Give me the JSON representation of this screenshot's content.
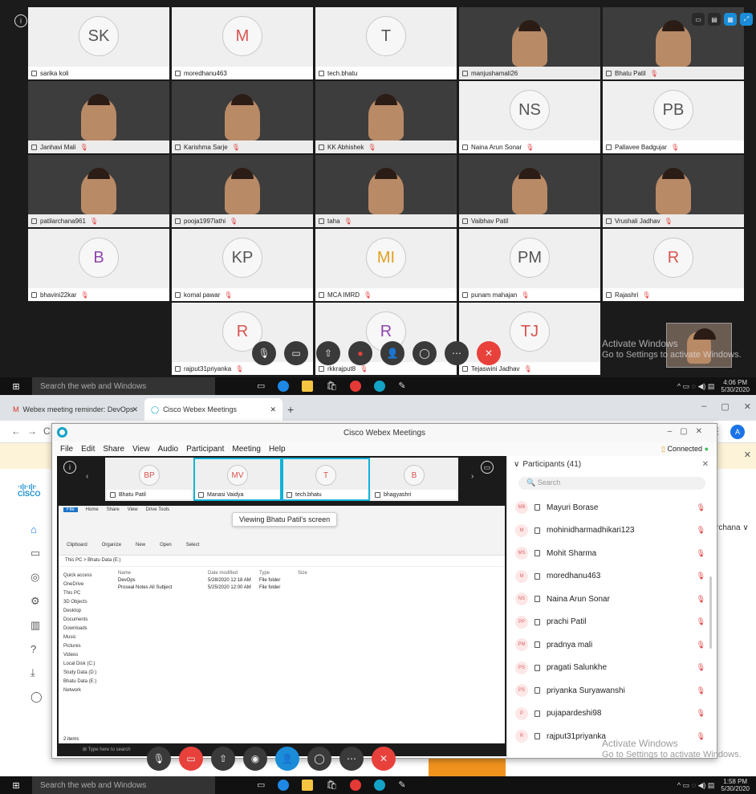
{
  "top": {
    "tiles": [
      {
        "name": "sarika koli",
        "initials": "SK",
        "kind": "avatar",
        "color": "#555555",
        "mic": false
      },
      {
        "name": "moredhanu463",
        "initials": "M",
        "kind": "avatar",
        "color": "#d9534f",
        "mic": false
      },
      {
        "name": "tech.bhatu",
        "initials": "T",
        "kind": "avatar",
        "color": "#555555",
        "mic": false
      },
      {
        "name": "manjushamali26",
        "initials": "",
        "kind": "video",
        "mic": false
      },
      {
        "name": "Bhatu Patil",
        "initials": "",
        "kind": "video",
        "mic": true
      },
      {
        "name": "Janhavi Mali",
        "initials": "",
        "kind": "video",
        "mic": true
      },
      {
        "name": "Karishma Sarje",
        "initials": "",
        "kind": "video",
        "mic": true
      },
      {
        "name": "KK Abhishek",
        "initials": "",
        "kind": "video",
        "mic": true
      },
      {
        "name": "Naina Arun Sonar",
        "initials": "NS",
        "kind": "avatar",
        "color": "#555555",
        "mic": true
      },
      {
        "name": "Pallavee Badgujar",
        "initials": "PB",
        "kind": "avatar",
        "color": "#555555",
        "mic": true
      },
      {
        "name": "patilarchana961",
        "initials": "",
        "kind": "video",
        "mic": true
      },
      {
        "name": "pooja1997lathi",
        "initials": "",
        "kind": "video",
        "mic": true
      },
      {
        "name": "taha",
        "initials": "",
        "kind": "video",
        "mic": true
      },
      {
        "name": "Vaibhav Patil",
        "initials": "",
        "kind": "video",
        "mic": false
      },
      {
        "name": "Vrushali Jadhav",
        "initials": "",
        "kind": "video",
        "mic": true
      },
      {
        "name": "bhavini22kar",
        "initials": "B",
        "kind": "avatar",
        "color": "#8e44ad",
        "mic": true
      },
      {
        "name": "komal pawar",
        "initials": "KP",
        "kind": "avatar",
        "color": "#555555",
        "mic": true
      },
      {
        "name": "MCA IMRD",
        "initials": "MI",
        "kind": "avatar",
        "color": "#e0a020",
        "mic": true
      },
      {
        "name": "punam mahajan",
        "initials": "PM",
        "kind": "avatar",
        "color": "#555555",
        "mic": true
      },
      {
        "name": "Rajashri",
        "initials": "R",
        "kind": "avatar",
        "color": "#d9534f",
        "mic": true
      },
      {
        "name": "",
        "initials": "",
        "kind": "empty",
        "mic": false
      },
      {
        "name": "rajput31priyanka",
        "initials": "R",
        "kind": "avatar",
        "color": "#d9534f",
        "mic": true
      },
      {
        "name": "rkkrajput8",
        "initials": "R",
        "kind": "avatar",
        "color": "#8e44ad",
        "mic": true
      },
      {
        "name": "Tejaswini Jadhav",
        "initials": "TJ",
        "kind": "avatar",
        "color": "#d9534f",
        "mic": true
      },
      {
        "name": "",
        "initials": "",
        "kind": "empty",
        "mic": false
      }
    ],
    "activate_title": "Activate Windows",
    "activate_sub": "Go to Settings to activate Windows.",
    "taskbar_search": "Search the web and Windows",
    "time": "4:06 PM",
    "date": "5/30/2020"
  },
  "browser": {
    "tab1": "Webex meeting reminder: DevOps",
    "tab2": "Cisco Webex Meetings",
    "archana": "rchana",
    "logo": "CISCO"
  },
  "webex": {
    "title": "Cisco Webex Meetings",
    "menu": [
      "File",
      "Edit",
      "Share",
      "View",
      "Audio",
      "Participant",
      "Meeting",
      "Help"
    ],
    "connected": "Connected",
    "strip": [
      {
        "name": "Bhatu Patil",
        "initials": "BP",
        "sel": false
      },
      {
        "name": "Manasi Vaidya",
        "initials": "MV",
        "sel": true
      },
      {
        "name": "tech.bhatu",
        "initials": "T",
        "sel": true
      },
      {
        "name": "bhagyashri",
        "initials": "B",
        "sel": false
      }
    ],
    "viewing": "Viewing Bhatu Patil's screen",
    "explorer": {
      "tabs": [
        "File",
        "Home",
        "Share",
        "View",
        "Drive Tools"
      ],
      "groups": [
        "Clipboard",
        "Organize",
        "New",
        "Open",
        "Select"
      ],
      "path": "This PC  >  Bhatu Data (E:)",
      "tree": [
        "Quick access",
        "OneDrive",
        "This PC",
        "3D Objects",
        "Desktop",
        "Documents",
        "Downloads",
        "Music",
        "Pictures",
        "Videos",
        "Local Disk (C:)",
        "Study Data (D:)",
        "Bhatu Data (E:)",
        "Network"
      ],
      "headers": [
        "Name",
        "Date modified",
        "Type",
        "Size"
      ],
      "rows": [
        [
          "DevOps",
          "5/28/2020 12:18 AM",
          "File folder",
          ""
        ],
        [
          "Proseal Notes All Subject",
          "5/25/2020 12:00 AM",
          "File folder",
          ""
        ]
      ],
      "items": "2 items"
    },
    "participants_title": "Participants (41)",
    "search_placeholder": "Search",
    "participants": [
      {
        "initials": "MB",
        "name": "Mayuri Borase",
        "mic": true
      },
      {
        "initials": "M",
        "name": "mohinidharmadhikari123",
        "mic": true
      },
      {
        "initials": "MS",
        "name": "Mohit Sharma",
        "mic": true
      },
      {
        "initials": "M",
        "name": "moredhanu463",
        "mic": true
      },
      {
        "initials": "NS",
        "name": "Naina Arun Sonar",
        "mic": true
      },
      {
        "initials": "PP",
        "name": "prachi Patil",
        "mic": true
      },
      {
        "initials": "PM",
        "name": "pradnya mali",
        "mic": true
      },
      {
        "initials": "PS",
        "name": "pragati Salunkhe",
        "mic": true
      },
      {
        "initials": "PS",
        "name": "priyanka Suryawanshi",
        "mic": true
      },
      {
        "initials": "P",
        "name": "pujapardeshi98",
        "mic": true
      },
      {
        "initials": "R",
        "name": "rajput31priyanka",
        "mic": true
      }
    ]
  },
  "bottom_taskbar": {
    "search": "Search the web and Windows",
    "time": "1:58 PM",
    "date": "5/30/2020"
  }
}
